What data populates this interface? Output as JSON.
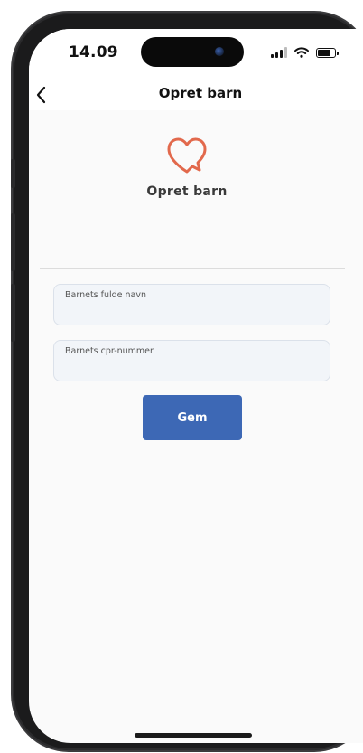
{
  "status_bar": {
    "time": "14.09",
    "icons": [
      "signal-icon",
      "wifi-icon",
      "battery-icon"
    ]
  },
  "nav": {
    "title": "Opret barn",
    "back_icon": "chevron-left-icon"
  },
  "hero": {
    "icon": "heart-chat-icon",
    "icon_color": "#e2694c",
    "title": "Opret barn"
  },
  "form": {
    "fields": [
      {
        "label": "Barnets fulde navn",
        "value": ""
      },
      {
        "label": "Barnets cpr-nummer",
        "value": ""
      }
    ],
    "submit_label": "Gem",
    "submit_color": "#3d68b5"
  }
}
